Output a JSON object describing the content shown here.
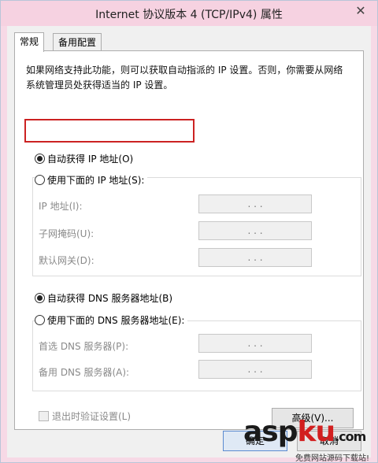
{
  "window": {
    "title": "Internet 协议版本 4 (TCP/IPv4) 属性",
    "close_glyph": "✕"
  },
  "tabs": [
    {
      "label": "常规",
      "active": true
    },
    {
      "label": "备用配置",
      "active": false
    }
  ],
  "description": "如果网络支持此功能，则可以获取自动指派的 IP 设置。否则，你需要从网络系统管理员处获得适当的 IP 设置。",
  "ip_mode": {
    "auto_label": "自动获得 IP 地址(O)",
    "manual_label": "使用下面的 IP 地址(S):",
    "selected": "auto",
    "fields": [
      {
        "label": "IP 地址(I):",
        "value": ".   .   ."
      },
      {
        "label": "子网掩码(U):",
        "value": ".   .   ."
      },
      {
        "label": "默认网关(D):",
        "value": ".   .   ."
      }
    ]
  },
  "dns_mode": {
    "auto_label": "自动获得 DNS 服务器地址(B)",
    "manual_label": "使用下面的 DNS 服务器地址(E):",
    "selected": "auto",
    "fields": [
      {
        "label": "首选 DNS 服务器(P):",
        "value": ".   .   ."
      },
      {
        "label": "备用 DNS 服务器(A):",
        "value": ".   .   ."
      }
    ]
  },
  "validate_on_exit": {
    "label": "退出时验证设置(L)",
    "checked": false
  },
  "buttons": {
    "advanced": "高级(V)...",
    "ok": "确定",
    "cancel": "取消"
  },
  "watermark": {
    "text_a": "asp",
    "text_b": "ku",
    "suffix": ".com",
    "sub": "免费网站源码下载站!"
  },
  "colors": {
    "highlight_border": "#cc2222",
    "titlebar": "#f6d2e1"
  }
}
